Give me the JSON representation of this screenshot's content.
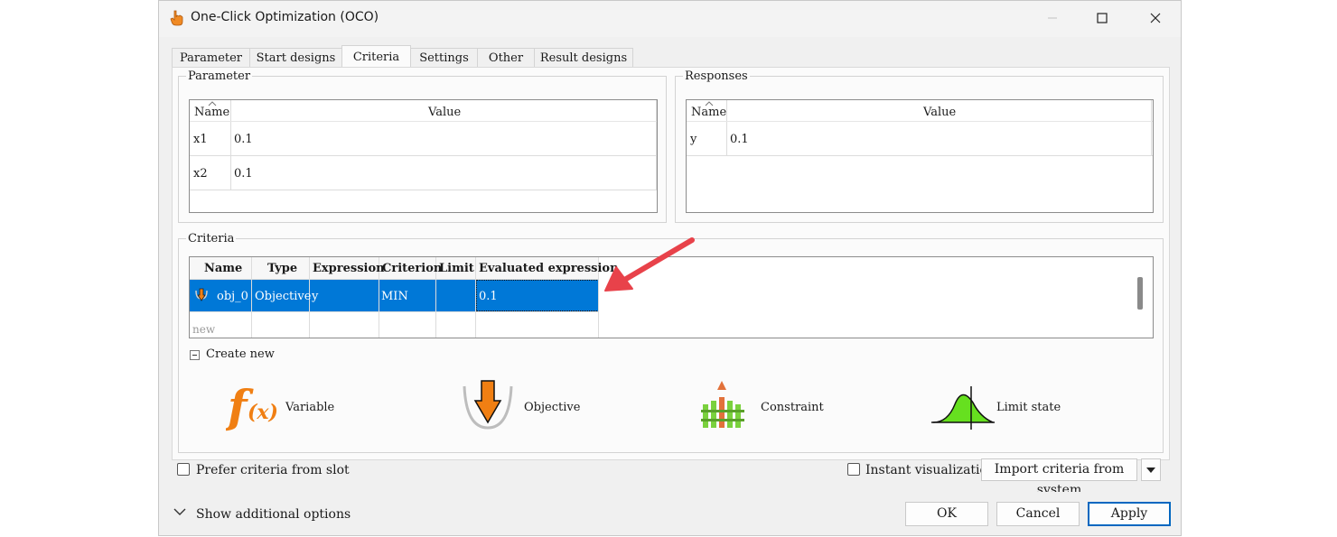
{
  "window": {
    "title": "One-Click Optimization (OCO)"
  },
  "tabs": [
    "Parameter",
    "Start designs",
    "Criteria",
    "Settings",
    "Other",
    "Result designs"
  ],
  "active_tab": "Criteria",
  "parameter_group": {
    "title": "Parameter",
    "headers": [
      "Name",
      "Value"
    ],
    "rows": [
      {
        "name": "x1",
        "value": "0.1"
      },
      {
        "name": "x2",
        "value": "0.1"
      }
    ]
  },
  "responses_group": {
    "title": "Responses",
    "headers": [
      "Name",
      "Value"
    ],
    "rows": [
      {
        "name": "y",
        "value": "0.1"
      }
    ]
  },
  "criteria_group": {
    "title": "Criteria",
    "headers": [
      "Name",
      "Type",
      "Expression",
      "Criterion",
      "Limit",
      "Evaluated expression"
    ],
    "rows": [
      {
        "name": "obj_0",
        "type": "Objective",
        "expression": "y",
        "criterion": "MIN",
        "limit": "",
        "evaluated": "0.1"
      }
    ],
    "new_row_label": "new",
    "create_new_label": "Create new",
    "create_items": [
      {
        "label": "Variable",
        "icon": "function-fx-icon"
      },
      {
        "label": "Objective",
        "icon": "objective-arrow-icon"
      },
      {
        "label": "Constraint",
        "icon": "constraint-fence-icon"
      },
      {
        "label": "Limit state",
        "icon": "limit-state-bell-icon"
      }
    ]
  },
  "options": {
    "prefer_slot_label": "Prefer criteria from slot",
    "instant_visualization_label": "Instant visualization",
    "import_label": "Import criteria from system"
  },
  "footer": {
    "show_additional_label": "Show additional options",
    "ok_label": "OK",
    "cancel_label": "Cancel",
    "apply_label": "Apply"
  },
  "colors": {
    "selection": "#0078d7",
    "annotation_arrow": "#e8424a",
    "accent_orange": "#f07f13",
    "constraint_green": "#7ad13d",
    "limit_green": "#66e01f"
  }
}
